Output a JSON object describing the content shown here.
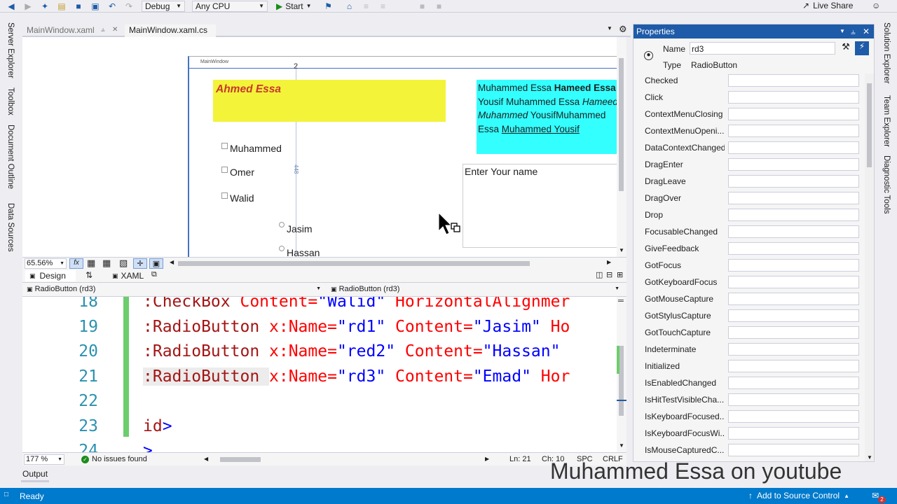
{
  "toolbar": {
    "config": "Debug",
    "platform": "Any CPU",
    "start": "Start",
    "live_share": "Live Share"
  },
  "left_rail": [
    "Server Explorer",
    "Toolbox",
    "Document Outline",
    "Data Sources"
  ],
  "right_rail": [
    "Solution Explorer",
    "Team Explorer",
    "Diagnostic Tools"
  ],
  "doc_tabs": [
    "MainWindow.xaml",
    "MainWindow.xaml.cs"
  ],
  "designer": {
    "window_title": "MainWindow",
    "dim_top": "2",
    "dim_left": "448",
    "yellow_text": "Ahmed Essa",
    "cyan_lines": [
      [
        {
          "t": "Muhammed Essa ",
          "s": "n"
        },
        {
          "t": "Hameed Essa",
          "s": "b"
        }
      ],
      [
        {
          "t": "Yousif Muhammed Essa ",
          "s": "n"
        },
        {
          "t": "Hameed",
          "s": "i"
        }
      ],
      [
        {
          "t": "Muhammed",
          "s": "i"
        },
        {
          "t": " YousifMuhammed",
          "s": "n"
        }
      ],
      [
        {
          "t": "Essa ",
          "s": "n"
        },
        {
          "t": "Muhammed Yousif",
          "s": "u"
        }
      ]
    ],
    "checkboxes": [
      "Muhammed",
      "Omer",
      "Walid"
    ],
    "radios": [
      "Jasim",
      "Hassan"
    ],
    "textbox": "Enter Your name",
    "zoom": "65.56%"
  },
  "split_tabs": {
    "design": "Design",
    "xaml": "XAML"
  },
  "nav": {
    "left": "RadioButton (rd3)",
    "right": "RadioButton (rd3)"
  },
  "code_lines": [
    {
      "n": "18",
      "parts": [
        {
          "t": ":CheckBox ",
          "c": "k-tag"
        },
        {
          "t": "Content=",
          "c": "k-attr"
        },
        {
          "t": "\"Walid\"",
          "c": "k-val"
        },
        {
          "t": " HorizontalAlignmer",
          "c": "k-attr"
        }
      ]
    },
    {
      "n": "19",
      "parts": [
        {
          "t": ":RadioButton ",
          "c": "k-tag"
        },
        {
          "t": "x:Name=",
          "c": "k-attr"
        },
        {
          "t": "\"rd1\"",
          "c": "k-val"
        },
        {
          "t": " Content=",
          "c": "k-attr"
        },
        {
          "t": "\"Jasim\"",
          "c": "k-val"
        },
        {
          "t": " Ho",
          "c": "k-attr"
        }
      ]
    },
    {
      "n": "20",
      "parts": [
        {
          "t": ":RadioButton ",
          "c": "k-tag"
        },
        {
          "t": "x:Name=",
          "c": "k-attr"
        },
        {
          "t": "\"red2\"",
          "c": "k-val"
        },
        {
          "t": " Content=",
          "c": "k-attr"
        },
        {
          "t": "\"Hassan\"",
          "c": "k-val"
        }
      ]
    },
    {
      "n": "21",
      "parts": [
        {
          "t": ":RadioButton ",
          "c": "k-tag"
        },
        {
          "t": "x:Name=",
          "c": "k-attr"
        },
        {
          "t": "\"rd3\"",
          "c": "k-val"
        },
        {
          "t": " Content=",
          "c": "k-attr"
        },
        {
          "t": "\"Emad\"",
          "c": "k-val"
        },
        {
          "t": " Hor",
          "c": "k-attr"
        }
      ]
    },
    {
      "n": "22",
      "parts": []
    },
    {
      "n": "23",
      "parts": [
        {
          "t": "id",
          "c": "k-tag"
        },
        {
          "t": ">",
          "c": "k-punct"
        }
      ]
    },
    {
      "n": "24",
      "parts": [
        {
          "t": ">",
          "c": "k-punct"
        }
      ]
    }
  ],
  "editor_status": {
    "zoom": "177 %",
    "issues": "No issues found",
    "ln": "Ln: 21",
    "ch": "Ch: 10",
    "spc": "SPC",
    "crlf": "CRLF"
  },
  "output_tab": "Output",
  "properties": {
    "title": "Properties",
    "name_label": "Name",
    "name_value": "rd3",
    "type_label": "Type",
    "type_value": "RadioButton",
    "events": [
      "Checked",
      "Click",
      "ContextMenuClosing",
      "ContextMenuOpeni...",
      "DataContextChanged",
      "DragEnter",
      "DragLeave",
      "DragOver",
      "Drop",
      "FocusableChanged",
      "GiveFeedback",
      "GotFocus",
      "GotKeyboardFocus",
      "GotMouseCapture",
      "GotStylusCapture",
      "GotTouchCapture",
      "Indeterminate",
      "Initialized",
      "IsEnabledChanged",
      "IsHitTestVisibleCha...",
      "IsKeyboardFocused...",
      "IsKeyboardFocusWi...",
      "IsMouseCapturedC..."
    ]
  },
  "statusbar": {
    "ready": "Ready",
    "source_control": "Add to Source Control",
    "badge": "2"
  },
  "watermark": "Muhammed Essa on youtube",
  "colors": {
    "accent": "#007acc",
    "yellow": "#f3f33a",
    "cyan": "#33ffff",
    "change_bar": "#6ccd6c"
  }
}
